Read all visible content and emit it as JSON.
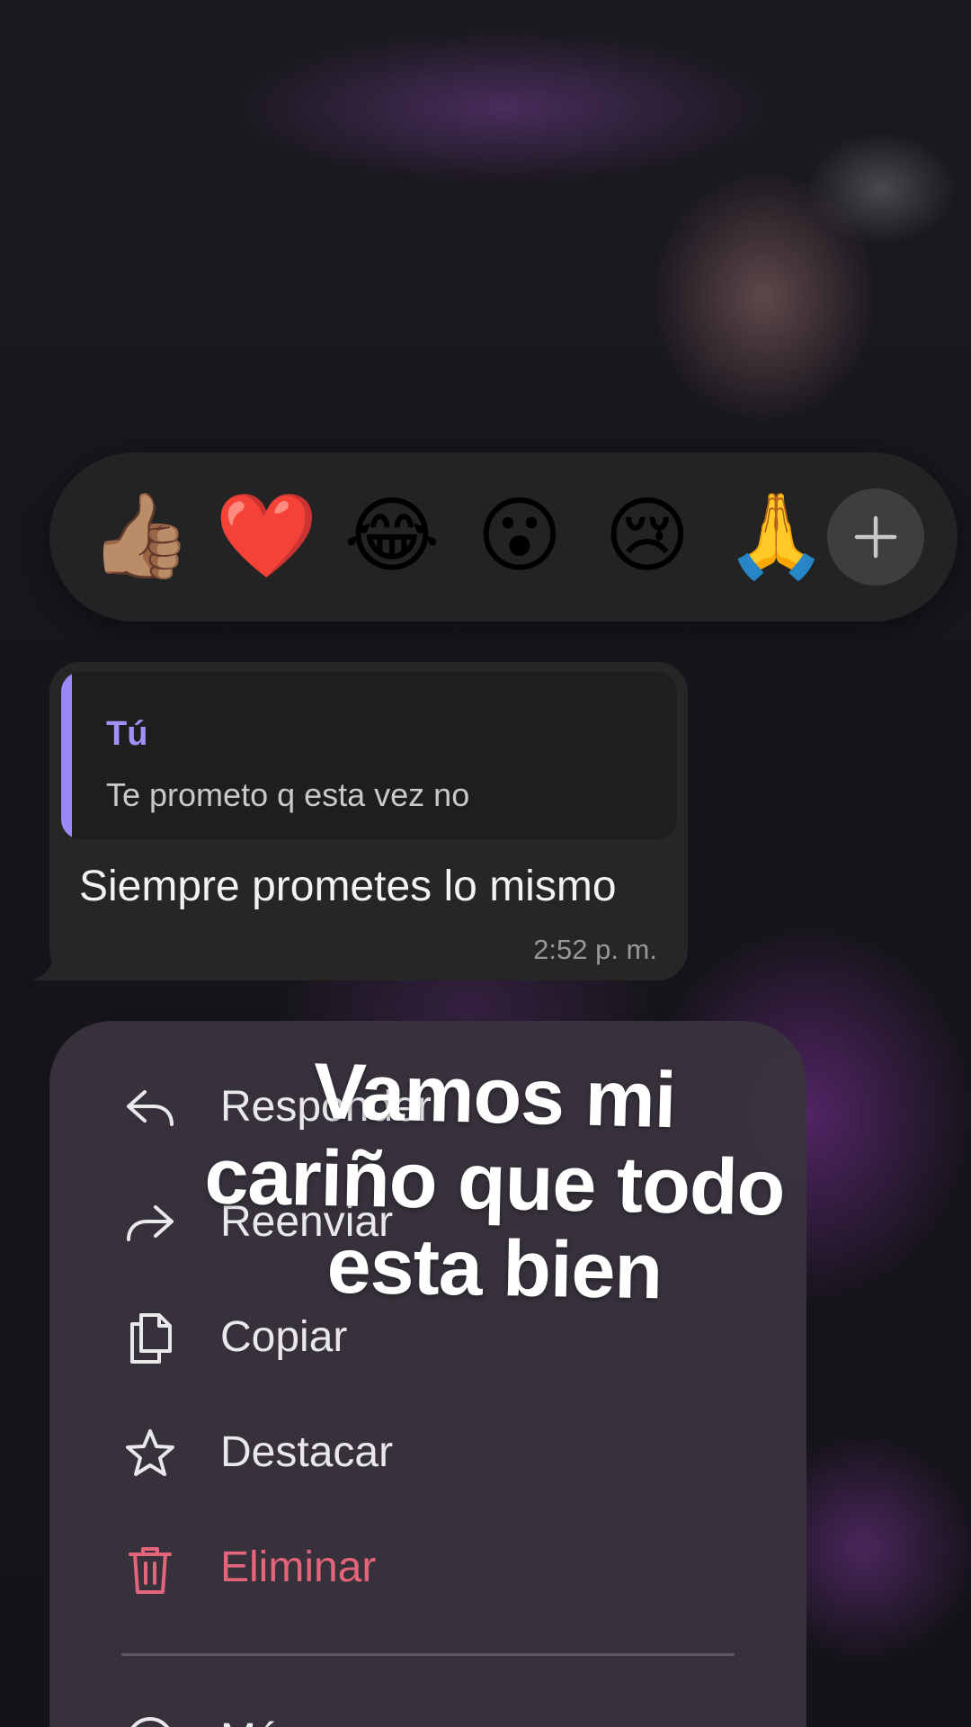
{
  "reactions": {
    "items": [
      {
        "name": "thumbs-up",
        "glyph": "👍🏽"
      },
      {
        "name": "heart",
        "glyph": "❤️"
      },
      {
        "name": "tears-of-joy",
        "glyph": "😂"
      },
      {
        "name": "surprised",
        "glyph": "😮"
      },
      {
        "name": "crying",
        "glyph": "😢"
      },
      {
        "name": "pray",
        "glyph": "🙏"
      }
    ],
    "add_icon": "plus-icon"
  },
  "message": {
    "quote": {
      "author": "Tú",
      "text": "Te prometo q esta vez no"
    },
    "text": "Siempre prometes lo mismo",
    "time": "2:52 p. m."
  },
  "menu": {
    "items": [
      {
        "label": "Responder",
        "icon": "reply-icon"
      },
      {
        "label": "Reenviar",
        "icon": "forward-icon"
      },
      {
        "label": "Copiar",
        "icon": "copy-icon"
      },
      {
        "label": "Destacar",
        "icon": "star-icon"
      },
      {
        "label": "Eliminar",
        "icon": "trash-icon",
        "color": "#e4647a"
      }
    ],
    "more_label": "Más"
  },
  "caption": {
    "line1": "Vamos mi",
    "line2": "cariño que todo",
    "line3": "esta bien"
  },
  "colors": {
    "accent": "#9b87f5",
    "danger": "#e4647a"
  }
}
